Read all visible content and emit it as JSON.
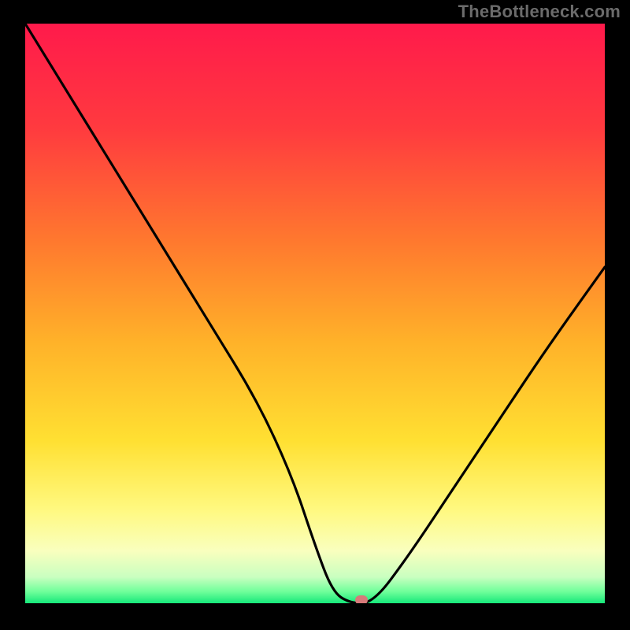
{
  "watermark": "TheBottleneck.com",
  "chart_data": {
    "type": "line",
    "title": "",
    "xlabel": "",
    "ylabel": "",
    "xlim": [
      0,
      100
    ],
    "ylim": [
      0,
      100
    ],
    "grid": false,
    "legend": false,
    "series": [
      {
        "name": "bottleneck-curve",
        "x": [
          0,
          8,
          16,
          24,
          32,
          40,
          46,
          50,
          53,
          56,
          60,
          66,
          74,
          82,
          90,
          100
        ],
        "values": [
          100,
          87,
          74,
          61,
          48,
          35,
          22,
          10,
          2,
          0,
          0,
          8,
          20,
          32,
          44,
          58
        ]
      }
    ],
    "marker": {
      "x": 58,
      "y": 0,
      "color": "#d77a7a"
    },
    "gradient_stops": [
      {
        "offset": 0,
        "color": "#ff1a4b"
      },
      {
        "offset": 0.18,
        "color": "#ff3a3f"
      },
      {
        "offset": 0.38,
        "color": "#ff7a2e"
      },
      {
        "offset": 0.55,
        "color": "#ffb229"
      },
      {
        "offset": 0.72,
        "color": "#ffe032"
      },
      {
        "offset": 0.84,
        "color": "#fff981"
      },
      {
        "offset": 0.91,
        "color": "#f9ffbe"
      },
      {
        "offset": 0.955,
        "color": "#c9ffc0"
      },
      {
        "offset": 0.98,
        "color": "#6fff9a"
      },
      {
        "offset": 1.0,
        "color": "#16e87a"
      }
    ]
  }
}
